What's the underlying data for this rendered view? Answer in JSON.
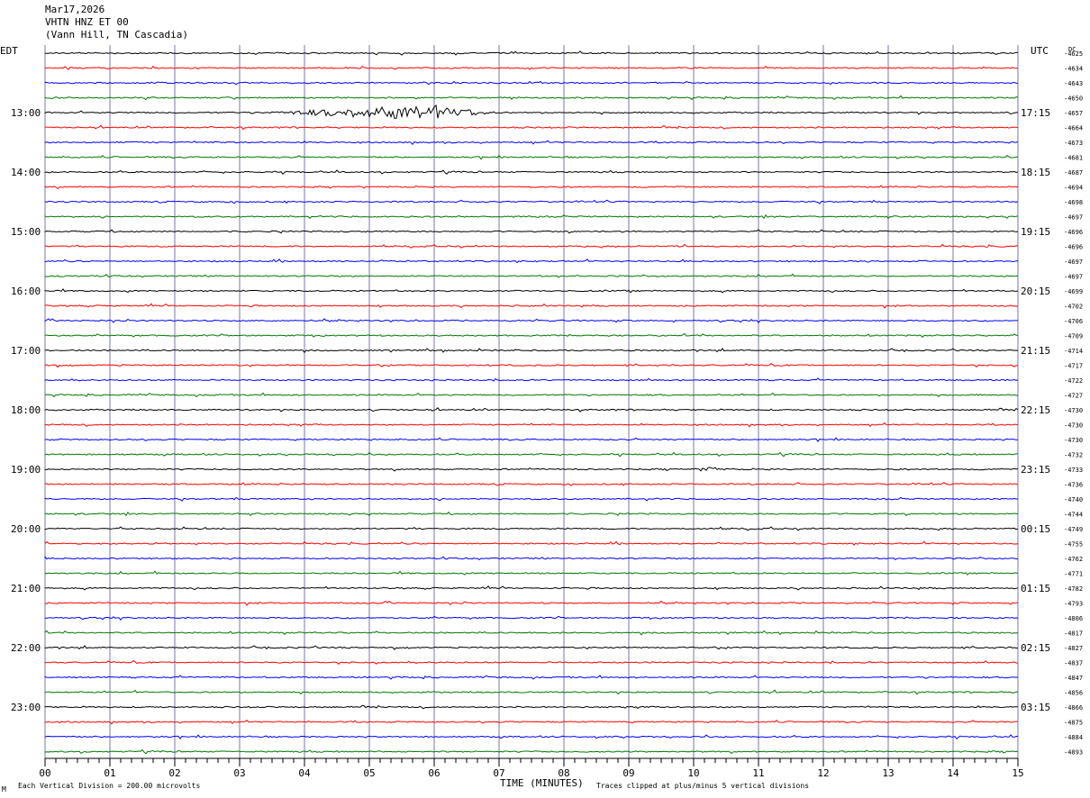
{
  "header": {
    "date": "Mar17,2026",
    "station": "VHTN HNZ ET 00",
    "location": "(Vann Hill, TN Cascadia)"
  },
  "left_zone": "EDT",
  "right_zone": "UTC",
  "dc_label": "DC",
  "footer": {
    "scale": "Each Vertical Division =  200.00 microvolts",
    "clip": "Traces clipped at plus/minus 5 vertical divisions",
    "mark": "M"
  },
  "colors": {
    "trace": [
      "#000000",
      "#ff0000",
      "#0000ff",
      "#007700"
    ],
    "grid": "#7777aa"
  },
  "chart_data": {
    "type": "line",
    "title": "VHTN HNZ ET 00 (Vann Hill, TN Cascadia)",
    "xlabel": "TIME (MINUTES)",
    "x_ticks": [
      "00",
      "01",
      "02",
      "03",
      "04",
      "05",
      "06",
      "07",
      "08",
      "09",
      "10",
      "11",
      "12",
      "13",
      "14",
      "15"
    ],
    "xlim": [
      0,
      15
    ],
    "left_hour_labels": [
      "13:00",
      "14:00",
      "15:00",
      "16:00",
      "17:00",
      "18:00",
      "19:00",
      "20:00",
      "21:00",
      "22:00",
      "23:00"
    ],
    "right_hour_labels": [
      "17:15",
      "18:15",
      "19:15",
      "20:15",
      "21:15",
      "22:15",
      "23:15",
      "00:15",
      "01:15",
      "02:15",
      "03:15"
    ],
    "dc_offsets": [
      "-4625",
      "-4634",
      "-4643",
      "-4650",
      "-4657",
      "-4664",
      "-4673",
      "-4681",
      "-4687",
      "-4694",
      "-4698",
      "-4697",
      "-4696",
      "-4696",
      "-4697",
      "-4697",
      "-4699",
      "-4702",
      "-4706",
      "-4709",
      "-4714",
      "-4717",
      "-4722",
      "-4727",
      "-4730",
      "-4730",
      "-4730",
      "-4732",
      "-4733",
      "-4736",
      "-4740",
      "-4744",
      "-4749",
      "-4755",
      "-4762",
      "-4771",
      "-4782",
      "-4793",
      "-4806",
      "-4817",
      "-4827",
      "-4837",
      "-4847",
      "-4856",
      "-4866",
      "-4875",
      "-4884",
      "-4893"
    ],
    "events": [
      {
        "row": 4,
        "start_min": 3.4,
        "peak_min": 5.8,
        "end_min": 7.0,
        "amplitude_divisions": 0.9
      },
      {
        "row": 28,
        "start_min": 10.1,
        "peak_min": 10.25,
        "end_min": 10.4,
        "amplitude_divisions": 0.5
      }
    ],
    "grid": true
  }
}
